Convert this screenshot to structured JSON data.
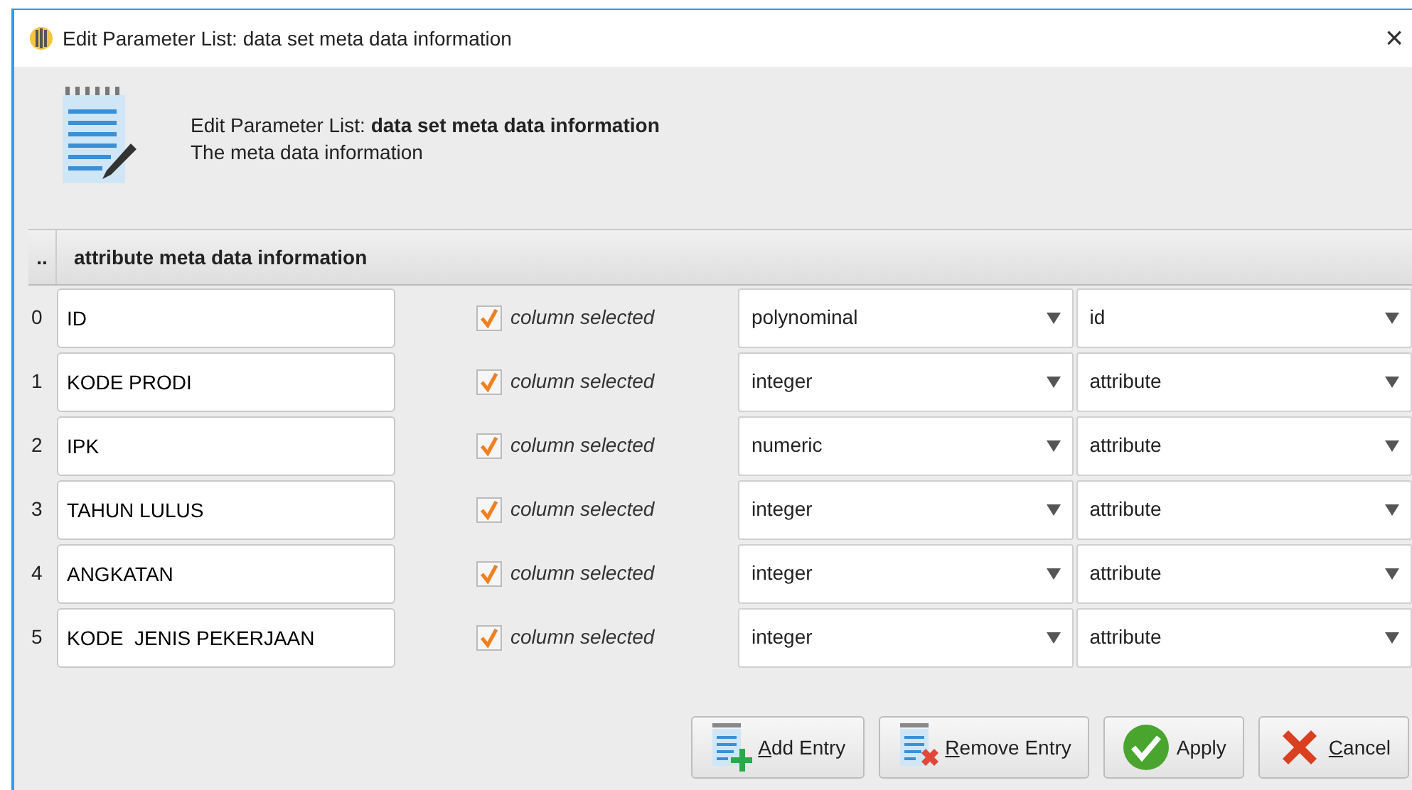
{
  "window": {
    "title": "Edit Parameter List: data set meta data information",
    "close": "×"
  },
  "header": {
    "title": "Edit Parameter List: **data set meta data information**",
    "subtitle": "The meta data information"
  },
  "table": {
    "columns": [
      {
        "label": ".."
      },
      {
        "label": "attribute meta data information"
      }
    ],
    "rows": [
      {
        "index": "0",
        "name": "ID",
        "checked": true,
        "check_label": "column selected",
        "type": "polynominal",
        "role": "id"
      },
      {
        "index": "1",
        "name": "KODE PRODI",
        "checked": true,
        "check_label": "column selected",
        "type": "integer",
        "role": "attribute"
      },
      {
        "index": "2",
        "name": "IPK",
        "checked": true,
        "check_label": "column selected",
        "type": "numeric",
        "role": "attribute"
      },
      {
        "index": "3",
        "name": "TAHUN LULUS",
        "checked": true,
        "check_label": "column selected",
        "type": "integer",
        "role": "attribute"
      },
      {
        "index": "4",
        "name": "ANGKATAN",
        "checked": true,
        "check_label": "column selected",
        "type": "integer",
        "role": "attribute"
      },
      {
        "index": "5",
        "name": "KODE  JENIS PEKERJAAN",
        "checked": true,
        "check_label": "column selected",
        "type": "integer",
        "role": "attribute"
      }
    ]
  },
  "buttons": [
    {
      "kind": "add",
      "label": "Add Entry",
      "mnemonic": true
    },
    {
      "kind": "remove",
      "label": "Remove Entry",
      "mnemonic": true
    },
    {
      "kind": "apply",
      "label": "Apply",
      "mnemonic": false
    },
    {
      "kind": "cancel",
      "label": "Cancel",
      "mnemonic": true
    }
  ]
}
